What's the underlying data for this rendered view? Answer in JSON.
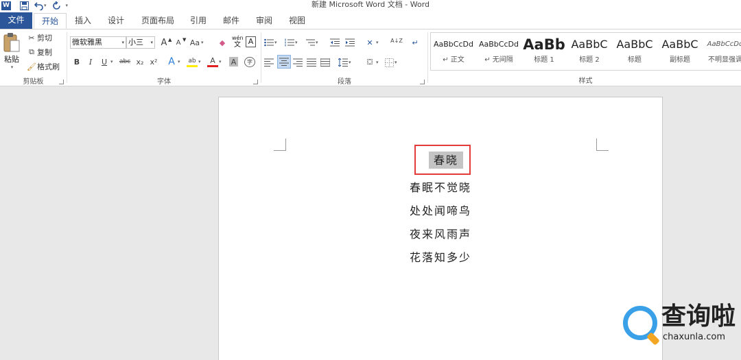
{
  "window": {
    "title": "新建 Microsoft Word 文档 - Word",
    "qat": {
      "app_icon": "W",
      "save_icon": "save-icon",
      "undo_icon": "undo-icon",
      "redo_icon": "redo-icon",
      "customize": "▾"
    }
  },
  "tabs": [
    {
      "label": "文件"
    },
    {
      "label": "开始"
    },
    {
      "label": "插入"
    },
    {
      "label": "设计"
    },
    {
      "label": "页面布局"
    },
    {
      "label": "引用"
    },
    {
      "label": "邮件"
    },
    {
      "label": "审阅"
    },
    {
      "label": "视图"
    }
  ],
  "clipboard": {
    "label": "剪贴板",
    "paste": "粘贴",
    "cut": "剪切",
    "copy": "复制",
    "format_painter": "格式刷"
  },
  "font": {
    "label": "字体",
    "font_name": "微软雅黑",
    "font_size": "小三",
    "grow": "A",
    "shrink": "A",
    "case": "Aa",
    "phonetic_top": "wén",
    "phonetic_bottom": "文",
    "border_char": "A",
    "bold": "B",
    "italic": "I",
    "underline": "U",
    "strike": "abc",
    "sub": "x₂",
    "sup": "x²",
    "effects": "A",
    "highlight": "ab",
    "color": "A",
    "shade": "A",
    "enclose": "字"
  },
  "paragraph": {
    "label": "段落",
    "sort": "A↓Z",
    "marks": "↵"
  },
  "styles": {
    "label": "样式",
    "items": [
      {
        "preview": "AaBbCcDd",
        "name": "↵ 正文"
      },
      {
        "preview": "AaBbCcDd",
        "name": "↵ 无间隔"
      },
      {
        "preview": "AaBb",
        "name": "标题 1"
      },
      {
        "preview": "AaBbC",
        "name": "标题 2"
      },
      {
        "preview": "AaBbC",
        "name": "标题"
      },
      {
        "preview": "AaBbC",
        "name": "副标题"
      },
      {
        "preview": "AaBbCcDd",
        "name": "不明显强调"
      }
    ]
  },
  "document": {
    "title": "春晓",
    "lines": [
      "春眠不觉晓",
      "处处闻啼鸟",
      "夜来风雨声",
      "花落知多少"
    ]
  },
  "watermark": {
    "title": "查询啦",
    "sub": "chaxunla.com"
  },
  "colors": {
    "accent": "#2b579a",
    "highlight_box": "#e33b3b",
    "selection": "#c4c4c4"
  }
}
